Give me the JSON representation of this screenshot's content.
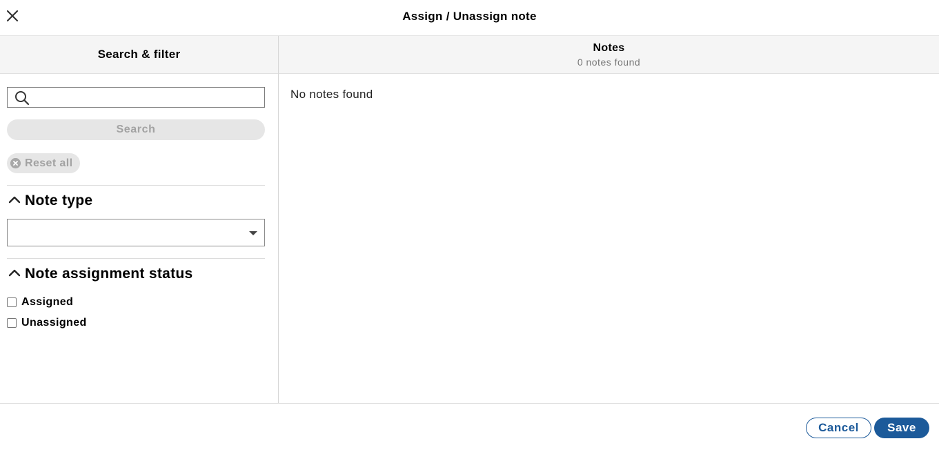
{
  "header": {
    "title": "Assign / Unassign note",
    "close_icon": "close-icon"
  },
  "filter_panel": {
    "heading": "Search & filter",
    "search": {
      "value": "",
      "placeholder": "",
      "icon": "search-icon"
    },
    "search_button_label": "Search",
    "reset_button_label": "Reset all",
    "note_type": {
      "title": "Note type",
      "selected": ""
    },
    "assignment_status": {
      "title": "Note assignment status",
      "options": [
        {
          "label": "Assigned",
          "checked": false
        },
        {
          "label": "Unassigned",
          "checked": false
        }
      ]
    }
  },
  "notes_panel": {
    "heading": "Notes",
    "count_text": "0 notes found",
    "empty_message": "No notes found"
  },
  "footer": {
    "cancel_label": "Cancel",
    "save_label": "Save"
  },
  "colors": {
    "primary": "#1c5a9a",
    "disabled_bg": "#e6e6e6",
    "disabled_text": "#a2a2a2",
    "panel_header_bg": "#f5f5f5"
  }
}
